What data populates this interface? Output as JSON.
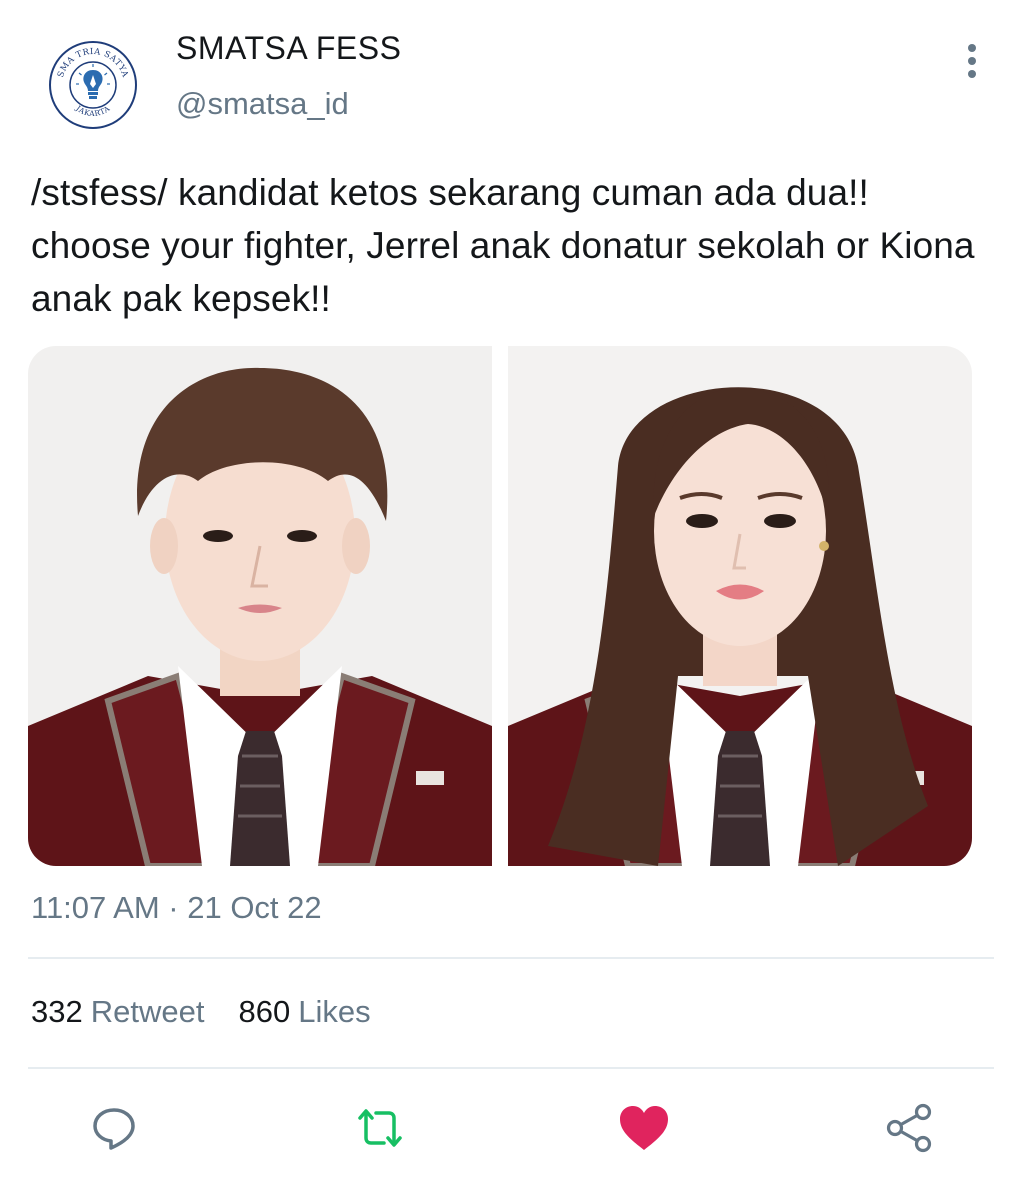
{
  "account": {
    "display_name": "SMATSA FESS",
    "handle": "@smatsa_id",
    "avatar_logo": {
      "top_text": "SMA TRIA SATYA",
      "bottom_text": "JAKARTA"
    }
  },
  "tweet": {
    "text": "/stsfess/ kandidat ketos sekarang cuman ada dua!! choose your fighter, Jerrel anak donatur sekolah or Kiona anak pak kepsek!!",
    "timestamp": "11:07 AM · 21 Oct 22"
  },
  "stats": {
    "retweets_count": "332",
    "retweets_label": "Retweet",
    "likes_count": "860",
    "likes_label": "Likes"
  },
  "icons": {
    "more": "more-vertical-icon",
    "reply": "reply-icon",
    "retweet": "retweet-icon",
    "like": "heart-icon",
    "share": "share-icon"
  },
  "colors": {
    "text": "#14171a",
    "secondary": "#657786",
    "retweet_green": "#17bf63",
    "like_red": "#e0245e",
    "icon_gray": "#657786",
    "logo_blue": "#2b6cb0",
    "blazer": "#5e1418"
  }
}
